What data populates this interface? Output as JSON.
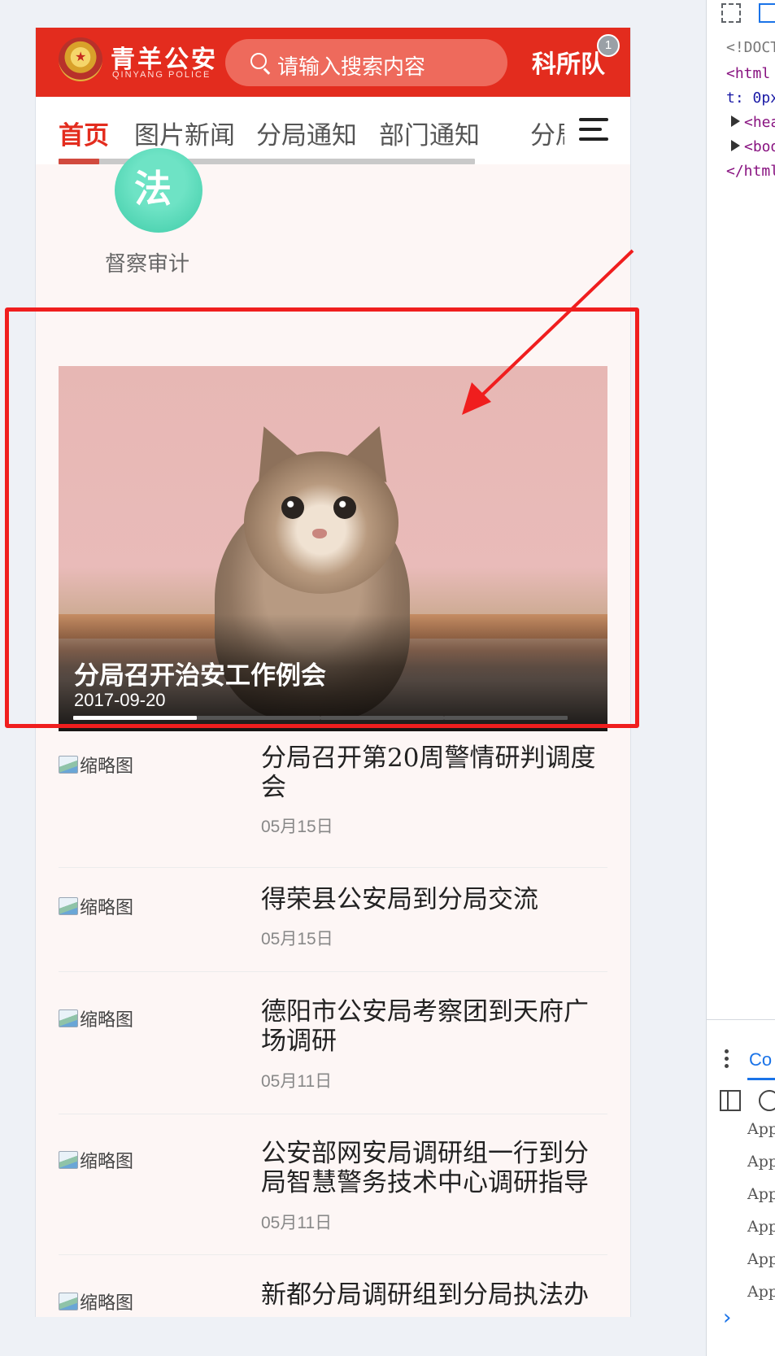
{
  "header": {
    "brand_name": "青羊公安",
    "brand_sub": "QINYANG POLICE",
    "search_placeholder": "请输入搜索内容",
    "unit_label": "科所队",
    "badge_count": "1"
  },
  "tabs": {
    "items": [
      {
        "label": "首页",
        "active": true
      },
      {
        "label": "图片新闻",
        "active": false
      },
      {
        "label": "分局通知",
        "active": false
      },
      {
        "label": "部门通知",
        "active": false
      },
      {
        "label": "分局",
        "active": false
      }
    ]
  },
  "quick_links": [
    {
      "glyph": "法",
      "label": "督察审计",
      "icon": "law-icon",
      "color": "#3ccaa6"
    }
  ],
  "carousel": {
    "title": "分局召开治安工作例会",
    "date": "2017-09-20",
    "image": "kitten-photo",
    "slide_count": 4,
    "active_index": 0
  },
  "news": {
    "thumb_alt": "缩略图",
    "items": [
      {
        "title": "分局召开第20周警情研判调度会",
        "date": "05月15日"
      },
      {
        "title": "得荣县公安局到分局交流",
        "date": "05月15日"
      },
      {
        "title": "德阳市公安局考察团到天府广场调研",
        "date": "05月11日"
      },
      {
        "title": "公安部网安局调研组一行到分局智慧警务技术中心调研指导",
        "date": "05月11日"
      },
      {
        "title": "新都分局调研组到分局执法办",
        "date": ""
      }
    ]
  },
  "devtools": {
    "lines": [
      "<!DOCT",
      "<html",
      "t: 0px",
      "<hea",
      "<bod",
      "</html"
    ],
    "console_tab": "Co",
    "log_prefix": "App",
    "log_count": 6
  },
  "colors": {
    "brand_red": "#e32c1e",
    "annotation_red": "#f01e1e",
    "devtools_blue": "#1a73e8"
  }
}
